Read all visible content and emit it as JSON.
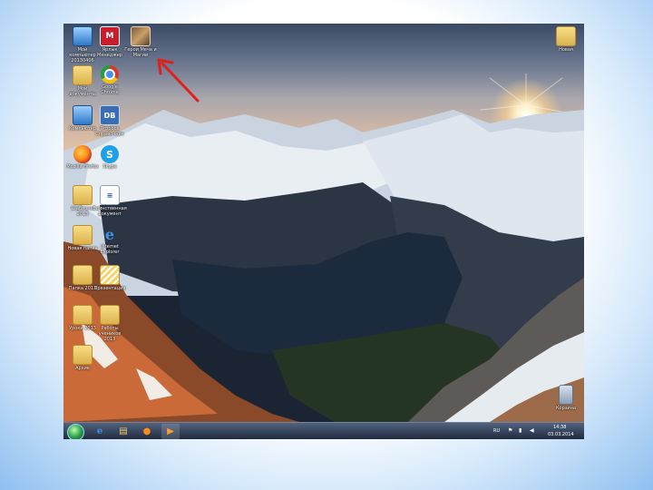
{
  "desktop": {
    "icons": [
      {
        "label": "Мой компьютер 20130406",
        "icon": "monitor-icon",
        "kind": "monitor"
      },
      {
        "label": "Ярлык Менеджер",
        "icon": "shield-icon",
        "kind": "shield",
        "glyph": "M"
      },
      {
        "label": "Герои Меча и Магии",
        "icon": "game-icon",
        "kind": "game"
      },
      {
        "label": "Мои документы",
        "icon": "folder-icon",
        "kind": "folder"
      },
      {
        "label": "Google Chrome",
        "icon": "chrome-icon",
        "kind": "chrome"
      },
      {
        "label": "Компьютер",
        "icon": "computer-icon",
        "kind": "monitor"
      },
      {
        "label": "Dropbox Справочник",
        "icon": "db-icon",
        "kind": "db",
        "glyph": "DB"
      },
      {
        "label": "Mozilla Firefox",
        "icon": "firefox-icon",
        "kind": "firefox"
      },
      {
        "label": "Skype",
        "icon": "skype-icon",
        "kind": "skype",
        "glyph": "S"
      },
      {
        "label": "Шаблоны 2013",
        "icon": "folder-icon",
        "kind": "folder"
      },
      {
        "label": "Единственная документ",
        "icon": "document-icon",
        "kind": "doc",
        "glyph": "≡"
      },
      {
        "label": "Новая папка",
        "icon": "folder-icon",
        "kind": "folder"
      },
      {
        "label": "Internet Explorer",
        "icon": "ie-icon",
        "kind": "ie",
        "glyph": "e"
      },
      {
        "label": "Папка 2013",
        "icon": "folder-icon",
        "kind": "folder"
      },
      {
        "label": "Презентация",
        "icon": "stripes-folder-icon",
        "kind": "stripes"
      },
      {
        "label": "Уроки 2013",
        "icon": "folder-icon",
        "kind": "folder"
      },
      {
        "label": "Работы учеников 2013",
        "icon": "folder-icon",
        "kind": "folder"
      },
      {
        "label": "Архив",
        "icon": "folder-icon",
        "kind": "folder"
      },
      {
        "label": "Новая",
        "icon": "folder-icon",
        "kind": "folder"
      },
      {
        "label": "Корзина",
        "icon": "recycle-bin-icon",
        "kind": "trash"
      }
    ]
  },
  "taskbar": {
    "pinned": [
      {
        "icon": "ie-icon",
        "glyph": "e",
        "color": "#3d93e6"
      },
      {
        "icon": "explorer-icon",
        "glyph": "▤",
        "color": "#f2cf6b"
      },
      {
        "icon": "firefox-icon",
        "glyph": "●",
        "color": "#ff8a1e"
      },
      {
        "icon": "media-player-icon",
        "glyph": "▶",
        "color": "#ff9a2e"
      }
    ],
    "language": "RU",
    "time": "14:38",
    "date": "03.03.2014"
  },
  "colors": {
    "frame_glow": "#8fc0f0",
    "taskbar": "#2a3a55",
    "arrow": "#e0201c"
  }
}
